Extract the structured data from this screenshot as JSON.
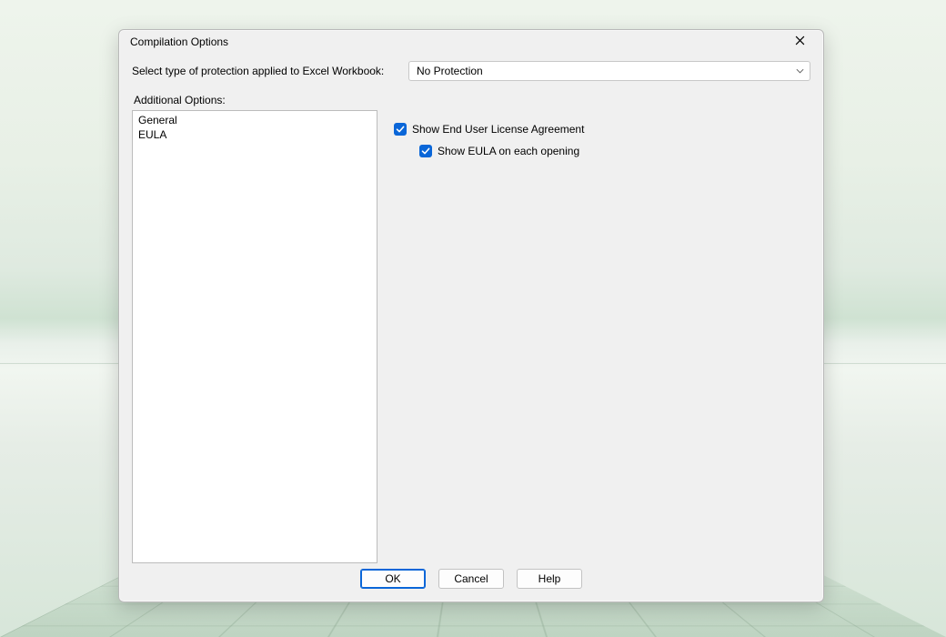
{
  "dialog": {
    "title": "Compilation Options",
    "protection_label": "Select type of protection applied to Excel Workbook:",
    "protection_selected": "No Protection",
    "additional_label": "Additional Options:",
    "list_items": [
      "General",
      "EULA"
    ],
    "list_selected_index": 1,
    "checkboxes": {
      "show_eula": {
        "label": "Show End User License Agreement",
        "checked": true
      },
      "show_eula_each": {
        "label": "Show EULA on each opening",
        "checked": true
      }
    },
    "buttons": {
      "ok": "OK",
      "cancel": "Cancel",
      "help": "Help"
    }
  },
  "colors": {
    "accent": "#0a66d8",
    "dialog_bg": "#f0f0f0",
    "border": "#bcbcbc"
  }
}
